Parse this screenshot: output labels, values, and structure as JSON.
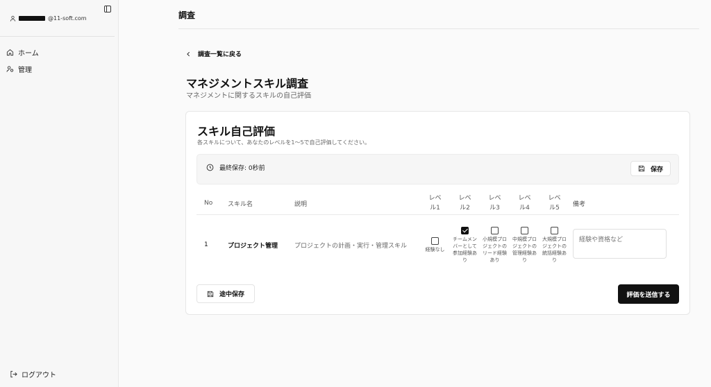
{
  "sidebar": {
    "user_email_suffix": "@11-soft.com",
    "nav": [
      {
        "label": "ホーム",
        "icon": "home-icon"
      },
      {
        "label": "管理",
        "icon": "users-icon"
      }
    ],
    "logout_label": "ログアウト"
  },
  "header": {
    "title": "調査"
  },
  "back_link": "調査一覧に戻る",
  "page": {
    "title": "マネジメントスキル調査",
    "subtitle": "マネジメントに関するスキルの自己評価"
  },
  "card": {
    "title": "スキル自己評価",
    "description": "各スキルについて、あなたのレベルを1〜5で自己評価してください。",
    "save_status": "最終保存: 0秒前",
    "save_label": "保存",
    "columns": {
      "no": "No",
      "name": "スキル名",
      "desc": "説明",
      "lv1": "レベ ル1",
      "lv2": "レベ ル2",
      "lv3": "レベ ル3",
      "lv4": "レベ ル4",
      "lv5": "レベ ル5",
      "note": "備考"
    },
    "rows": [
      {
        "no": "1",
        "name": "プロジェクト管理",
        "desc": "プロジェクトの計画・実行・管理スキル",
        "levels": [
          {
            "label": "経験なし",
            "checked": false
          },
          {
            "label": "チームメンバーとして参加経験あり",
            "checked": true
          },
          {
            "label": "小規模プロジェクトのリード経験あり",
            "checked": false
          },
          {
            "label": "中規模プロジェクトの管理経験あり",
            "checked": false
          },
          {
            "label": "大規模プロジェクトの統括経験あり",
            "checked": false
          }
        ],
        "note_placeholder": "経験や資格など"
      }
    ],
    "draft_label": "途中保存",
    "submit_label": "評価を送信する"
  }
}
